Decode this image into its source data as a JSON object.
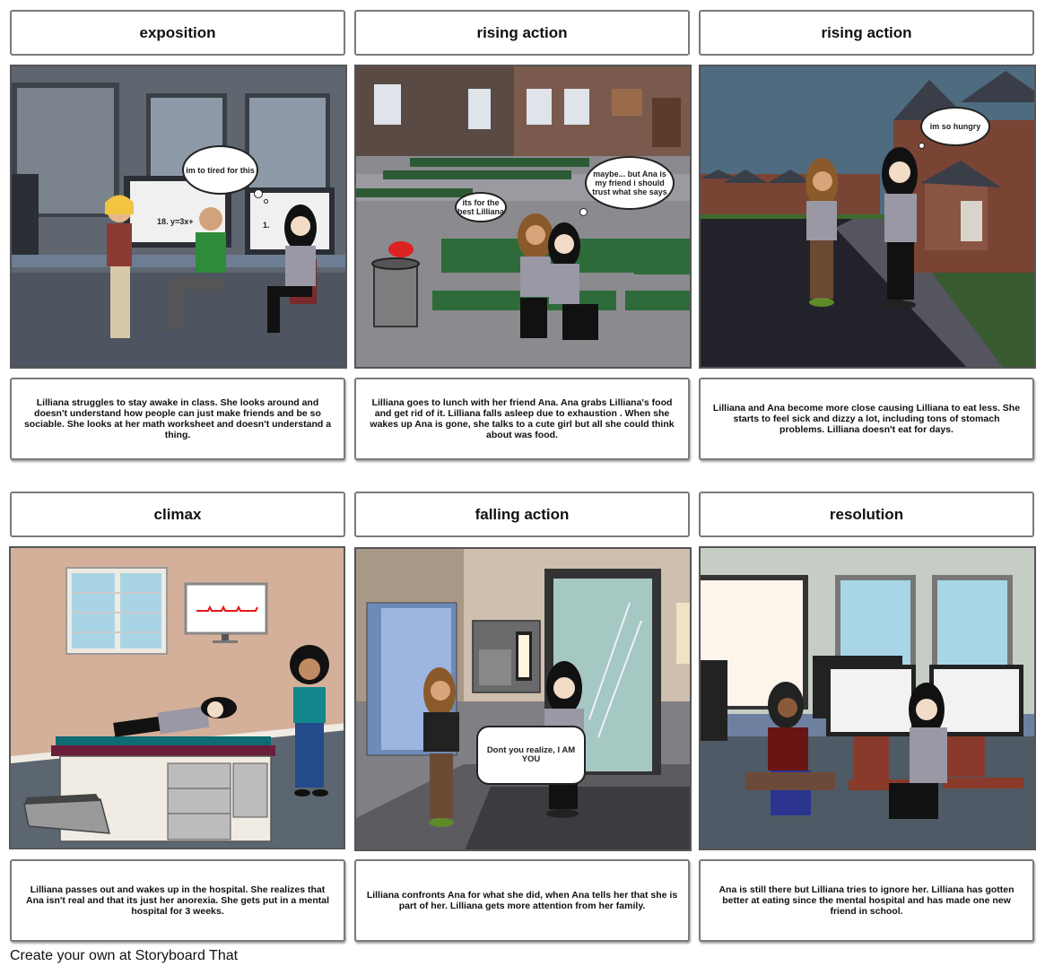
{
  "storyboard": {
    "panels": [
      {
        "title": "exposition",
        "caption": "Lilliana struggles to stay awake in class. She looks around and doesn't understand how people can just make friends and be so sociable. She looks at her math worksheet and doesn't understand a thing.",
        "scene": {
          "setting": "computer classroom",
          "bubbles": [
            {
              "type": "thought",
              "text": "im to tired for this"
            }
          ],
          "screen_texts": [
            "18. y=3x+",
            "1."
          ]
        }
      },
      {
        "title": "rising action",
        "caption": "Lilliana goes to lunch with her friend Ana. Ana grabs Lilliana's food and get rid of it. Lilliana falls asleep due to exhaustion . When she wakes up Ana is gone, she talks to a cute girl but all she could think about was food.",
        "scene": {
          "setting": "school cafeteria courtyard",
          "bubbles": [
            {
              "type": "speech",
              "text": "its for the best Lilliana"
            },
            {
              "type": "thought",
              "text": "maybe... but Ana is my friend i should trust what she says"
            }
          ]
        }
      },
      {
        "title": "rising action",
        "caption": "Lilliana and Ana become more close causing Lilliana to eat less. She starts to feel sick and dizzy a lot, including tons of stomach problems. Lilliana doesn't eat for days.",
        "scene": {
          "setting": "neighborhood street at dusk",
          "bubbles": [
            {
              "type": "thought",
              "text": "im so hungry"
            }
          ]
        }
      },
      {
        "title": "climax",
        "caption": "Lilliana passes out and wakes up in the hospital. She realizes that Ana isn't real and that its just her anorexia. She gets put in a mental hospital for 3 weeks.",
        "scene": {
          "setting": "hospital room",
          "bubbles": []
        }
      },
      {
        "title": "falling action",
        "caption": "Lilliana confronts Ana for what she did, when Ana tells her that she is part of her. Lilliana gets more attention from her family.",
        "scene": {
          "setting": "apartment lobby",
          "bubbles": [
            {
              "type": "speech",
              "text": "Dont you realize, I AM YOU"
            }
          ]
        }
      },
      {
        "title": "resolution",
        "caption": "Ana is still there but Lilliana tries to ignore her. Lilliana has gotten better at eating since the mental hospital and has made one new friend in school.",
        "scene": {
          "setting": "computer classroom",
          "bubbles": []
        }
      }
    ],
    "footer": "Create your own at Storyboard That"
  },
  "colors": {
    "frame_border": "#7a7a7a",
    "classroom_wall": "#5f6670",
    "cafeteria_floor": "#8a8a8f",
    "dusk_sky": "#4f6b80",
    "hospital_wall": "#d4b09a",
    "lobby_wall": "#cfbfae",
    "resolution_wall": "#c5cdc4"
  }
}
